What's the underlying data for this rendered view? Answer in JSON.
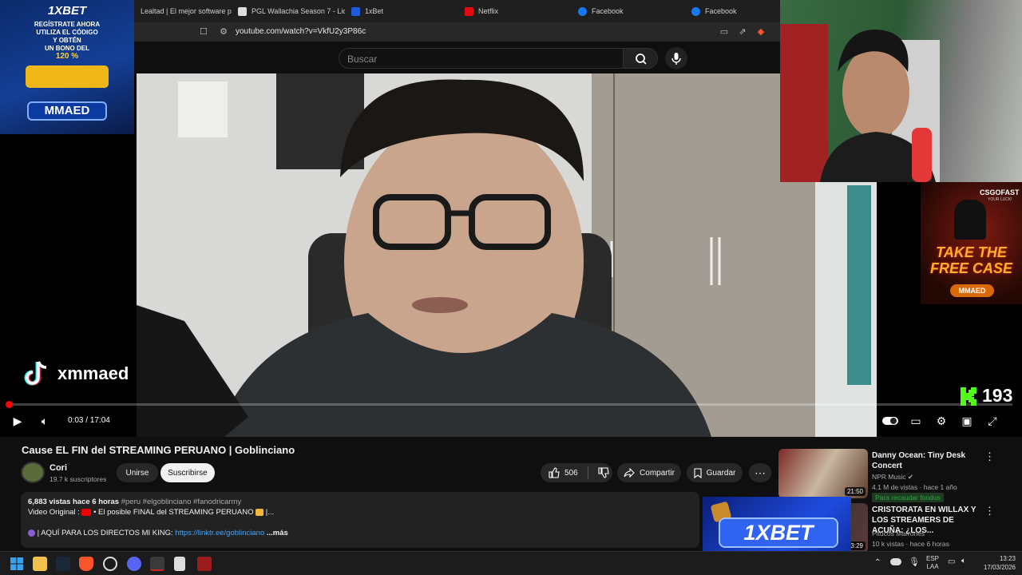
{
  "browser": {
    "tabs": [
      {
        "label": "Lealtad | El mejor software par",
        "color": "#888888"
      },
      {
        "label": "PGL Wallachia Season 7 - Liqu",
        "color": "#dddddd"
      },
      {
        "label": "1xBet",
        "color": "#1e5bd8"
      },
      {
        "label": "Netflix",
        "color": "#e50914"
      },
      {
        "label": "Facebook",
        "color": "#1877f2"
      },
      {
        "label": "Facebook",
        "color": "#1877f2"
      }
    ],
    "url": "youtube.com/watch?v=VkfU2y3P86c"
  },
  "youtube": {
    "search_placeholder": "Buscar",
    "time_label": "0:03 / 17:04",
    "progress_fraction": 0.003,
    "video_title": "Cause EL FIN del STREAMING PERUANO | Goblinciano",
    "channel": {
      "name": "Cori",
      "subscribers": "19.7 k suscriptores"
    },
    "join_label": "Unirse",
    "subscribe_label": "Suscribirse",
    "likes": "506",
    "share_label": "Compartir",
    "save_label": "Guardar",
    "description": {
      "stats": "6,883 vistas  hace 6 horas",
      "hashtags": "#peru #elgoblinciano #fanodricarmy",
      "line2_prefix": "Video Original : ",
      "line2_text": "• El posible FINAL del STREAMING PERUANO",
      "line2_suffix": " |...",
      "line3_prefix": "| AQUÍ PARA LOS DIRECTOS MI KING: ",
      "link": "https://linktr.ee/goblinciano",
      "more": "...más"
    },
    "recommendations": [
      {
        "title": "Danny Ocean: Tiny Desk Concert",
        "channel": "NPR Music",
        "meta": "4.1 M de vistas · hace 1 año",
        "duration": "21:50",
        "badge": "Para recaudar fondos"
      },
      {
        "title": "CRISTORATA EN WILLAX Y LOS STREAMERS DE ACUÑA: ¿LOS...",
        "channel": "Pitucos Marrones",
        "meta": "10 k vistas · hace 6 horas",
        "duration": "3:29"
      }
    ]
  },
  "overlays": {
    "ad_top_left": {
      "brand": "1XBET",
      "lines": [
        "REGÍSTRATE AHORA",
        "UTILIZA EL CÓDIGO",
        "Y OBTÉN",
        "UN BONO DEL"
      ],
      "bonus": "120 %",
      "code": "MMAED"
    },
    "tiktok_handle": "xmmaed",
    "kick_viewers": "193",
    "ad_right": {
      "brand": "CSGOFAST",
      "tagline": "YOUR LUCK!",
      "headline": "TAKE THE FREE CASE",
      "code": "MMAED"
    },
    "ad_bottom": {
      "brand": "1XBET"
    }
  },
  "taskbar": {
    "lang_top": "ESP",
    "lang_bottom": "LAA",
    "time": "13:23",
    "date": "17/03/2026"
  },
  "colors": {
    "accent_red": "#ff0000",
    "link_blue": "#3ea6ff",
    "badge_green": "#2ba640"
  }
}
